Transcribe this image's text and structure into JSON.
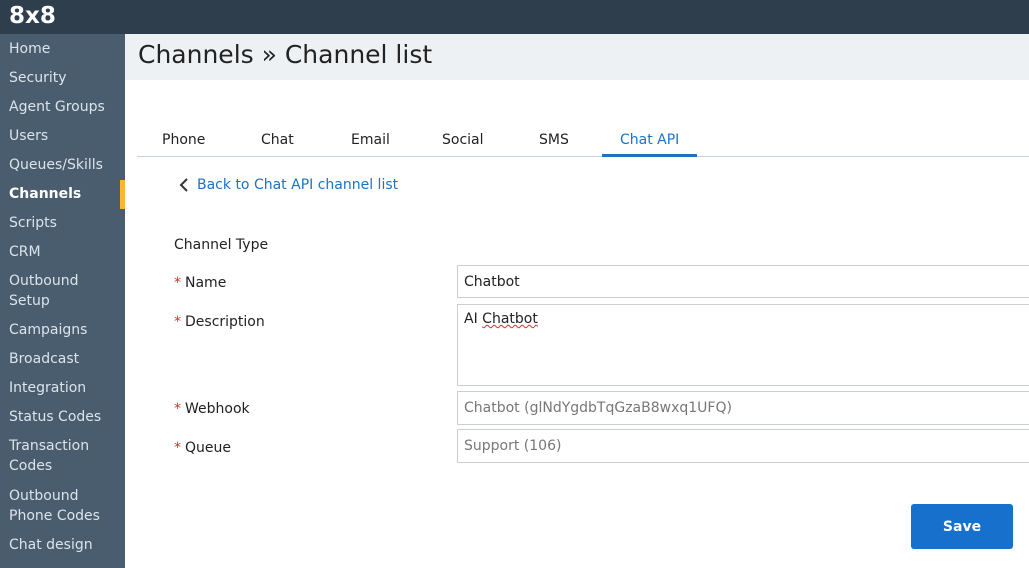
{
  "app": {
    "logo": "8x8"
  },
  "sidebar": {
    "items": [
      {
        "label": "Home"
      },
      {
        "label": "Security"
      },
      {
        "label": "Agent Groups"
      },
      {
        "label": "Users"
      },
      {
        "label": "Queues/Skills"
      },
      {
        "label": "Channels",
        "active": true
      },
      {
        "label": "Scripts"
      },
      {
        "label": "CRM"
      },
      {
        "label": "Outbound",
        "label2": "Setup"
      },
      {
        "label": "Campaigns"
      },
      {
        "label": "Broadcast"
      },
      {
        "label": "Integration"
      },
      {
        "label": "Status Codes"
      },
      {
        "label": "Transaction",
        "label2": "Codes"
      },
      {
        "label": "Outbound",
        "label2": "Phone Codes"
      },
      {
        "label": "Chat design"
      }
    ]
  },
  "header": {
    "title": "Channels » Channel list"
  },
  "tabs": [
    {
      "label": "Phone"
    },
    {
      "label": "Chat"
    },
    {
      "label": "Email"
    },
    {
      "label": "Social"
    },
    {
      "label": "SMS"
    },
    {
      "label": "Chat API",
      "active": true
    }
  ],
  "back_link": {
    "label": "Back to Chat API channel list",
    "icon": "chevron-left-icon"
  },
  "form": {
    "channel_type_label": "Channel Type",
    "required_mark": "*",
    "name": {
      "label": "Name",
      "value": "Chatbot"
    },
    "description": {
      "label": "Description",
      "value_word1": "AI",
      "value_word2": "Chatbot"
    },
    "webhook": {
      "label": "Webhook",
      "value": "Chatbot (glNdYgdbTqGzaB8wxq1UFQ)"
    },
    "queue": {
      "label": "Queue",
      "value": "Support (106)"
    },
    "save_label": "Save"
  },
  "colors": {
    "topbar": "#2f3e4c",
    "sidebar": "#4a5d6e",
    "active_marker": "#f5b82e",
    "accent": "#1a73c7",
    "required": "#d0312d"
  }
}
